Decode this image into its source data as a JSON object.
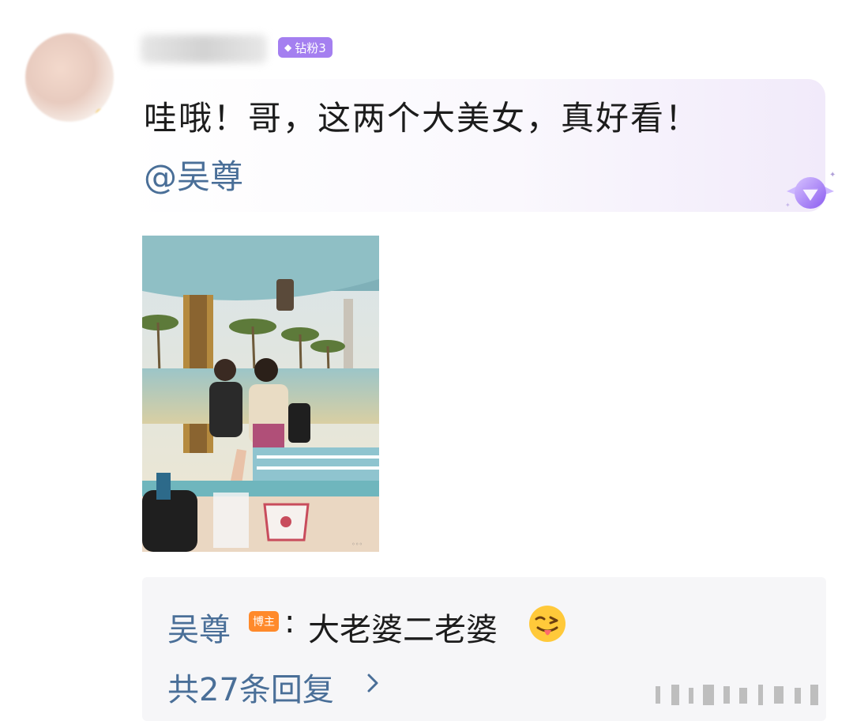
{
  "comment": {
    "fan_badge": "钻粉3",
    "text": "哇哦！哥，这两个大美女，真好看！",
    "mention": "@吴尊"
  },
  "reply": {
    "author": "吴尊",
    "author_tag": "博主",
    "separator": ":",
    "text": "大老婆二老婆",
    "total_replies": "共27条回复"
  },
  "icons": {
    "badge_icon": "diamond-icon",
    "crown": "diamond-crown-icon",
    "emoji": "tongue-wink-emoji",
    "more": "chevron-right-icon"
  },
  "colors": {
    "link": "#4a6f98",
    "badge": "#a47ff0",
    "blogger_tag": "#ff8a2b",
    "reply_bg": "#f6f6f8"
  }
}
